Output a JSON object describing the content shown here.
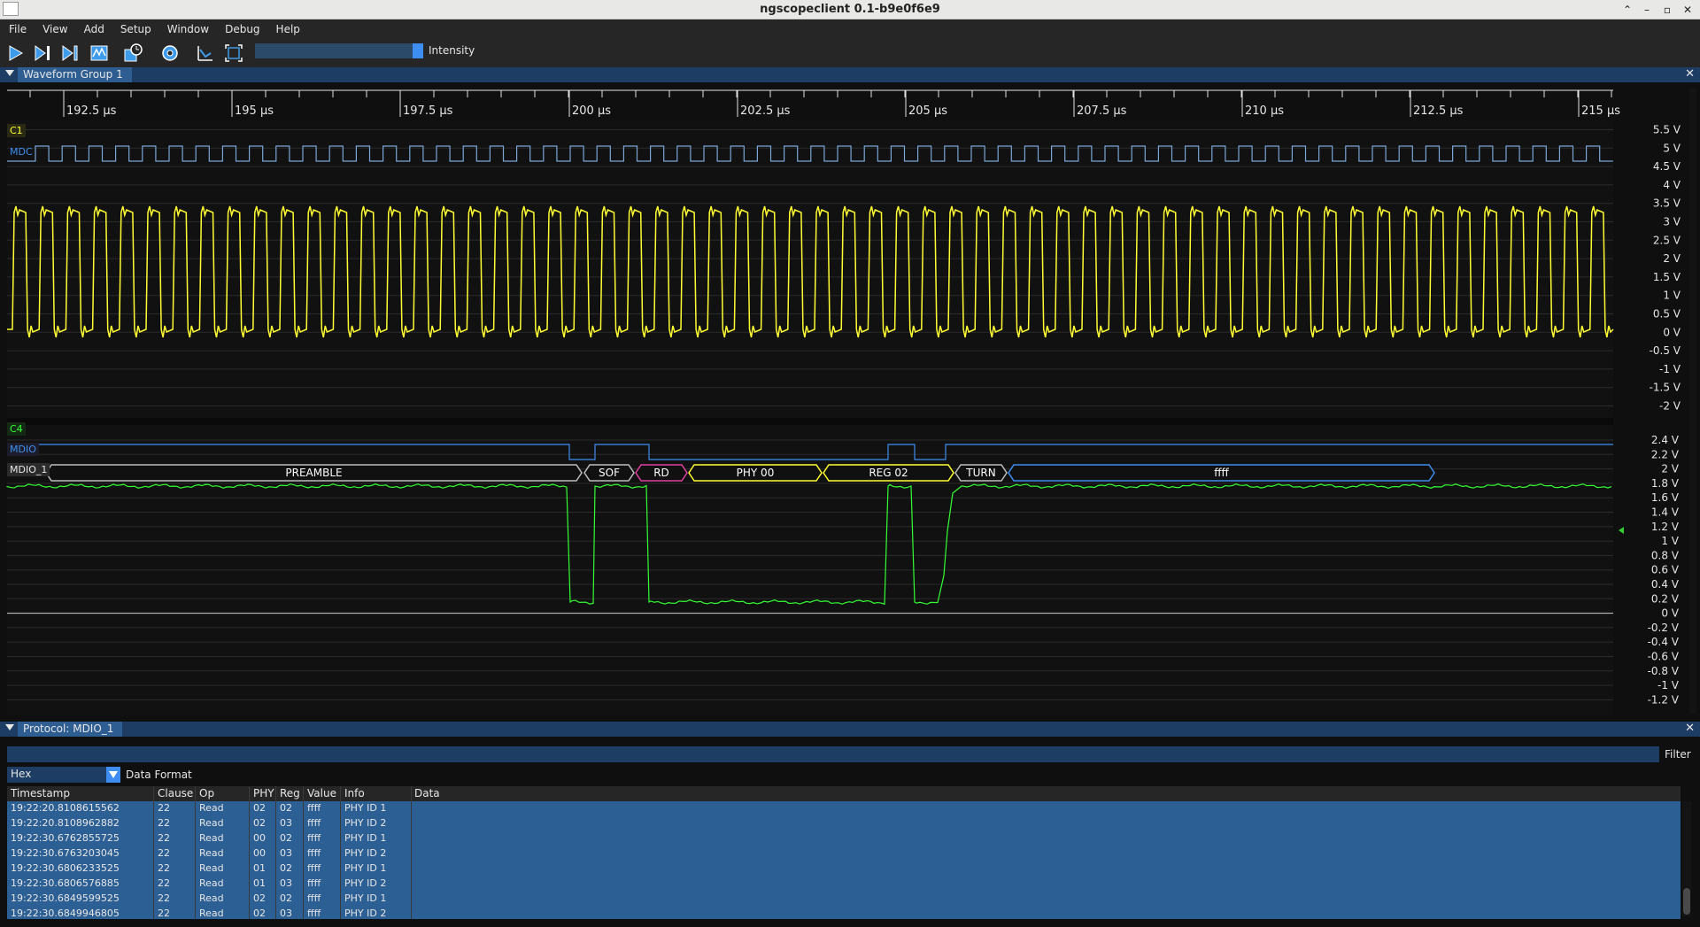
{
  "window": {
    "title": "ngscopeclient 0.1-b9e0f6e9"
  },
  "menu": [
    "File",
    "View",
    "Add",
    "Setup",
    "Window",
    "Debug",
    "Help"
  ],
  "toolbar": {
    "buttons": [
      "play-icon",
      "play-single-icon",
      "play-next-icon",
      "waveform-icon",
      "history-icon",
      "settings-icon",
      "measure-icon",
      "autoscale-icon"
    ],
    "intensity_label": "Intensity"
  },
  "waveform_group": {
    "title": "Waveform Group 1",
    "time_ticks": [
      "192.5 µs",
      "195 µs",
      "197.5 µs",
      "200 µs",
      "202.5 µs",
      "205 µs",
      "207.5 µs",
      "210 µs",
      "212.5 µs",
      "215 µs"
    ],
    "plot1": {
      "channel": "C1",
      "digital_label": "MDC",
      "v_ticks": [
        "5.5 V",
        "5 V",
        "4.5 V",
        "4 V",
        "3.5 V",
        "3 V",
        "2.5 V",
        "2 V",
        "1.5 V",
        "1 V",
        "0.5 V",
        "0 V",
        "-0.5 V",
        "-1 V",
        "-1.5 V",
        "-2 V"
      ],
      "color": "#ffff33"
    },
    "plot2": {
      "channel": "C4",
      "digital_label": "MDIO",
      "decode_label": "MDIO_1",
      "v_ticks": [
        "2.4 V",
        "2.2 V",
        "2 V",
        "1.8 V",
        "1.6 V",
        "1.4 V",
        "1.2 V",
        "1 V",
        "0.8 V",
        "0.6 V",
        "0.4 V",
        "0.2 V",
        "0 V",
        "-0.2 V",
        "-0.4 V",
        "-0.6 V",
        "-0.8 V",
        "-1 V",
        "-1.2 V"
      ],
      "color": "#33ff33",
      "decode_segments": [
        "PREAMBLE",
        "SOF",
        "RD",
        "PHY 00",
        "REG 02",
        "TURN",
        "ffff"
      ]
    }
  },
  "protocol": {
    "title": "Protocol: MDIO_1",
    "filter_label": "Filter",
    "format_value": "Hex",
    "format_label": "Data Format",
    "columns": [
      "Timestamp",
      "Clause",
      "Op",
      "PHY",
      "Reg",
      "Value",
      "Info",
      "Data"
    ],
    "rows": [
      [
        "19:22:20.8108615562",
        "22",
        "Read",
        "02",
        "02",
        "ffff",
        "PHY ID 1",
        ""
      ],
      [
        "19:22:20.8108962882",
        "22",
        "Read",
        "02",
        "03",
        "ffff",
        "PHY ID 2",
        ""
      ],
      [
        "19:22:30.6762855725",
        "22",
        "Read",
        "00",
        "02",
        "ffff",
        "PHY ID 1",
        ""
      ],
      [
        "19:22:30.6763203045",
        "22",
        "Read",
        "00",
        "03",
        "ffff",
        "PHY ID 2",
        ""
      ],
      [
        "19:22:30.6806233525",
        "22",
        "Read",
        "01",
        "02",
        "ffff",
        "PHY ID 1",
        ""
      ],
      [
        "19:22:30.6806576885",
        "22",
        "Read",
        "01",
        "03",
        "ffff",
        "PHY ID 2",
        ""
      ],
      [
        "19:22:30.6849599525",
        "22",
        "Read",
        "02",
        "02",
        "ffff",
        "PHY ID 1",
        ""
      ],
      [
        "19:22:30.6849946805",
        "22",
        "Read",
        "02",
        "03",
        "ffff",
        "PHY ID 2",
        ""
      ]
    ]
  }
}
